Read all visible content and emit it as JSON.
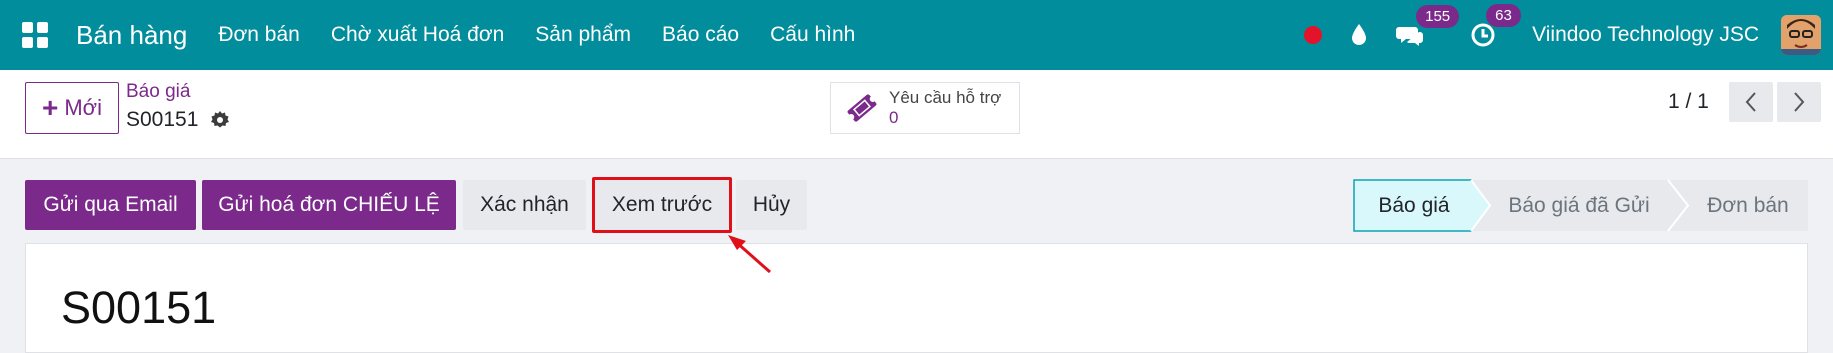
{
  "topbar": {
    "app_name": "Bán hàng",
    "menu": [
      "Đơn bán",
      "Chờ xuất Hoá đơn",
      "Sản phẩm",
      "Báo cáo",
      "Cấu hình"
    ],
    "messages_count": "155",
    "activities_count": "63",
    "company": "Viindoo Technology JSC"
  },
  "control_panel": {
    "new_label": "Mới",
    "breadcrumb_parent": "Báo giá",
    "breadcrumb_current": "S00151",
    "support_label": "Yêu cầu hỗ trợ",
    "support_count": "0",
    "pager": "1 / 1"
  },
  "actions": {
    "send_email": "Gửi qua Email",
    "send_proforma": "Gửi hoá đơn CHIẾU LỆ",
    "confirm": "Xác nhận",
    "preview": "Xem trước",
    "cancel": "Hủy"
  },
  "status_bar": {
    "stages": [
      "Báo giá",
      "Báo giá đã Gửi",
      "Đơn bán"
    ],
    "active_stage": "Báo giá"
  },
  "document": {
    "title": "S00151"
  },
  "colors": {
    "topbar": "#018d9c",
    "primary": "#7b2a8b",
    "active_stage": "#d9f8fc",
    "highlight": "#e0101a"
  },
  "icons": [
    "apps-icon",
    "record-icon",
    "drop-icon",
    "chat-icon",
    "clock-icon",
    "gear-icon",
    "ticket-icon",
    "chevron-left-icon",
    "chevron-right-icon"
  ]
}
